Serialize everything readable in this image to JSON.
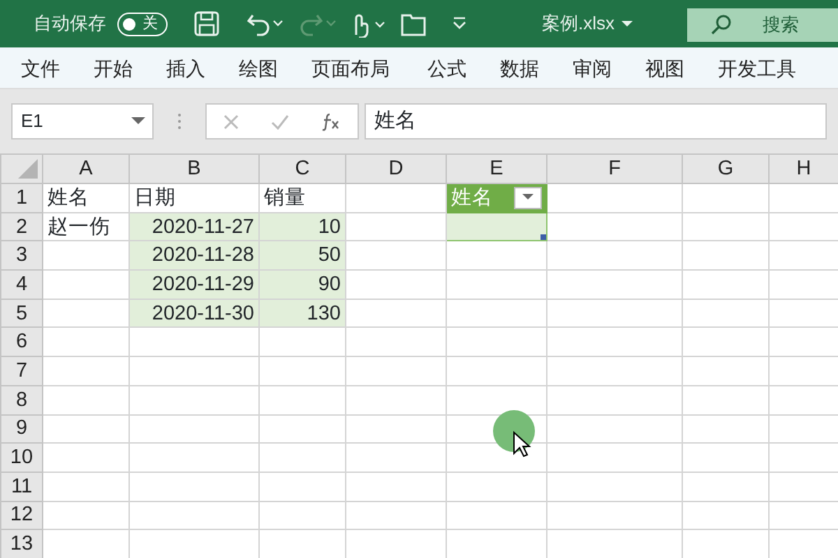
{
  "title_bar": {
    "autosave_label": "自动保存",
    "autosave_toggle": {
      "label": "关",
      "on": false
    },
    "file_name": "案例.xlsx",
    "search_placeholder": "搜索"
  },
  "ribbon_tabs": [
    "文件",
    "开始",
    "插入",
    "绘图",
    "页面布局",
    "公式",
    "数据",
    "审阅",
    "视图",
    "开发工具"
  ],
  "formula_bar": {
    "name_box": "E1",
    "formula": "姓名"
  },
  "columns": [
    "A",
    "B",
    "C",
    "D",
    "E",
    "F",
    "G",
    "H"
  ],
  "rows": [
    {
      "header": "1",
      "cells": [
        {
          "text": "姓名",
          "kind": "plain"
        },
        {
          "text": "日期",
          "kind": "plain"
        },
        {
          "text": "销量",
          "kind": "plain"
        },
        {
          "kind": "plain"
        },
        {
          "text": "姓名",
          "kind": "filter-header"
        },
        {
          "kind": "plain"
        },
        {
          "kind": "plain"
        },
        {
          "kind": "plain"
        }
      ]
    },
    {
      "header": "2",
      "cells": [
        {
          "text": "赵一伤",
          "kind": "plain"
        },
        {
          "text": "2020-11-27",
          "kind": "shaded-number"
        },
        {
          "text": "10",
          "kind": "shaded-number"
        },
        {
          "kind": "plain"
        },
        {
          "kind": "selected"
        },
        {
          "kind": "plain"
        },
        {
          "kind": "plain"
        },
        {
          "kind": "plain"
        }
      ]
    },
    {
      "header": "3",
      "cells": [
        {
          "kind": "plain"
        },
        {
          "text": "2020-11-28",
          "kind": "shaded-number"
        },
        {
          "text": "50",
          "kind": "shaded-number"
        },
        {
          "kind": "plain"
        },
        {
          "kind": "plain"
        },
        {
          "kind": "plain"
        },
        {
          "kind": "plain"
        },
        {
          "kind": "plain"
        }
      ]
    },
    {
      "header": "4",
      "cells": [
        {
          "kind": "plain"
        },
        {
          "text": "2020-11-29",
          "kind": "shaded-number"
        },
        {
          "text": "90",
          "kind": "shaded-number"
        },
        {
          "kind": "plain"
        },
        {
          "kind": "plain"
        },
        {
          "kind": "plain"
        },
        {
          "kind": "plain"
        },
        {
          "kind": "plain"
        }
      ]
    },
    {
      "header": "5",
      "cells": [
        {
          "kind": "plain"
        },
        {
          "text": "2020-11-30",
          "kind": "shaded-number"
        },
        {
          "text": "130",
          "kind": "shaded-number"
        },
        {
          "kind": "plain"
        },
        {
          "kind": "plain"
        },
        {
          "kind": "plain"
        },
        {
          "kind": "plain"
        },
        {
          "kind": "plain"
        }
      ]
    },
    {
      "header": "6",
      "cells": []
    },
    {
      "header": "7",
      "cells": []
    },
    {
      "header": "8",
      "cells": []
    },
    {
      "header": "9",
      "cells": []
    },
    {
      "header": "10",
      "cells": []
    },
    {
      "header": "11",
      "cells": []
    },
    {
      "header": "12",
      "cells": []
    },
    {
      "header": "13",
      "cells": []
    }
  ]
}
